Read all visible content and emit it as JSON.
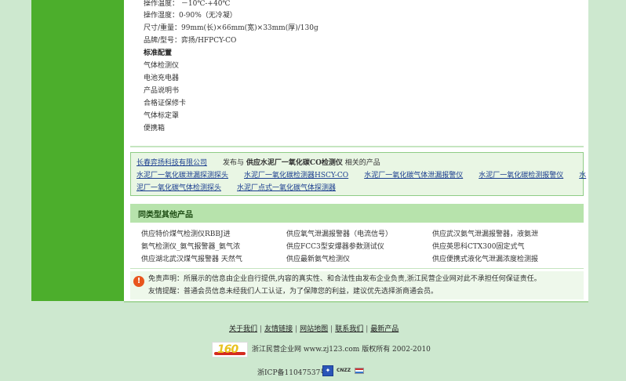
{
  "specs": {
    "temperature": "操作温度： －10℃-+40℃",
    "humidity": "操作湿度：0-90%（无冷凝）",
    "size_weight": "尺寸/重量：99mm(长)×66mm(宽)×33mm(厚)/130g",
    "brand_model": "品牌/型号：弈扬/HFPCY-CO",
    "standard_title": "标准配置",
    "items": [
      "气体检测仪",
      "电池充电器",
      "产品说明书",
      "合格证保修卡",
      "气体标定罩",
      "便携箱"
    ]
  },
  "related": {
    "company_link": "长春弈扬科技有限公司",
    "published_at": "发布与",
    "product_name": "供应水泥厂一氧化碳CO检测仪",
    "related_suffix": "相关的产品",
    "links_row2": [
      "水泥厂一氧化碳泄漏探测探头",
      "水泥厂一氧化碳检测器HSCY-CO",
      "水泥厂一氧化碳气体泄漏报警仪",
      "水泥厂一氧化碳检测报警仪",
      "水"
    ],
    "links_row3": [
      "泥厂一氧化碳气体检测探头",
      "水泥厂点式一氧化碳气体探测器"
    ]
  },
  "same_type": {
    "title": "同类型其他产品",
    "items": [
      "供应特价煤气检测仪RBBJ进",
      "供应氧气泄漏报警器（电流信号）",
      "供应武汉氨气泄漏报警器，液氨泄",
      "氨气检测仪_氨气报警器_氨气浓",
      "供应FCC3型安爆器参数测试仪",
      "供应英思科CTX300固定式气",
      "供应湖北武汉煤气报警器 天然气",
      "供应最新氨气检测仪",
      "供应便携式液化气泄漏浓度检测报"
    ]
  },
  "disclaimer": {
    "icon": "warning-icon",
    "line1": "免责声明：所展示的信息由企业自行提供,内容的真实性、和合法性由发布企业负责,浙江民营企业网对此不承担任何保证责任。",
    "line2": "友情提醒：普通会员信息未经我们人工认证，为了保障您的利益，建议优先选择浙商通会员。"
  },
  "footer": {
    "links": [
      "关于我们",
      "友情链接",
      "网站地图",
      "联系我们",
      "最新产品"
    ],
    "logo_text": "160",
    "copyright": "浙江民营企业网 www.zj123.com 版权所有  2002-2010",
    "icp": "浙ICP备11047537号-1",
    "badge_cnzz": "CNZZ",
    "colors": {
      "green_bar": "#4cae2c",
      "page_bg": "#cde8cf",
      "link": "#1a3d8f"
    }
  }
}
